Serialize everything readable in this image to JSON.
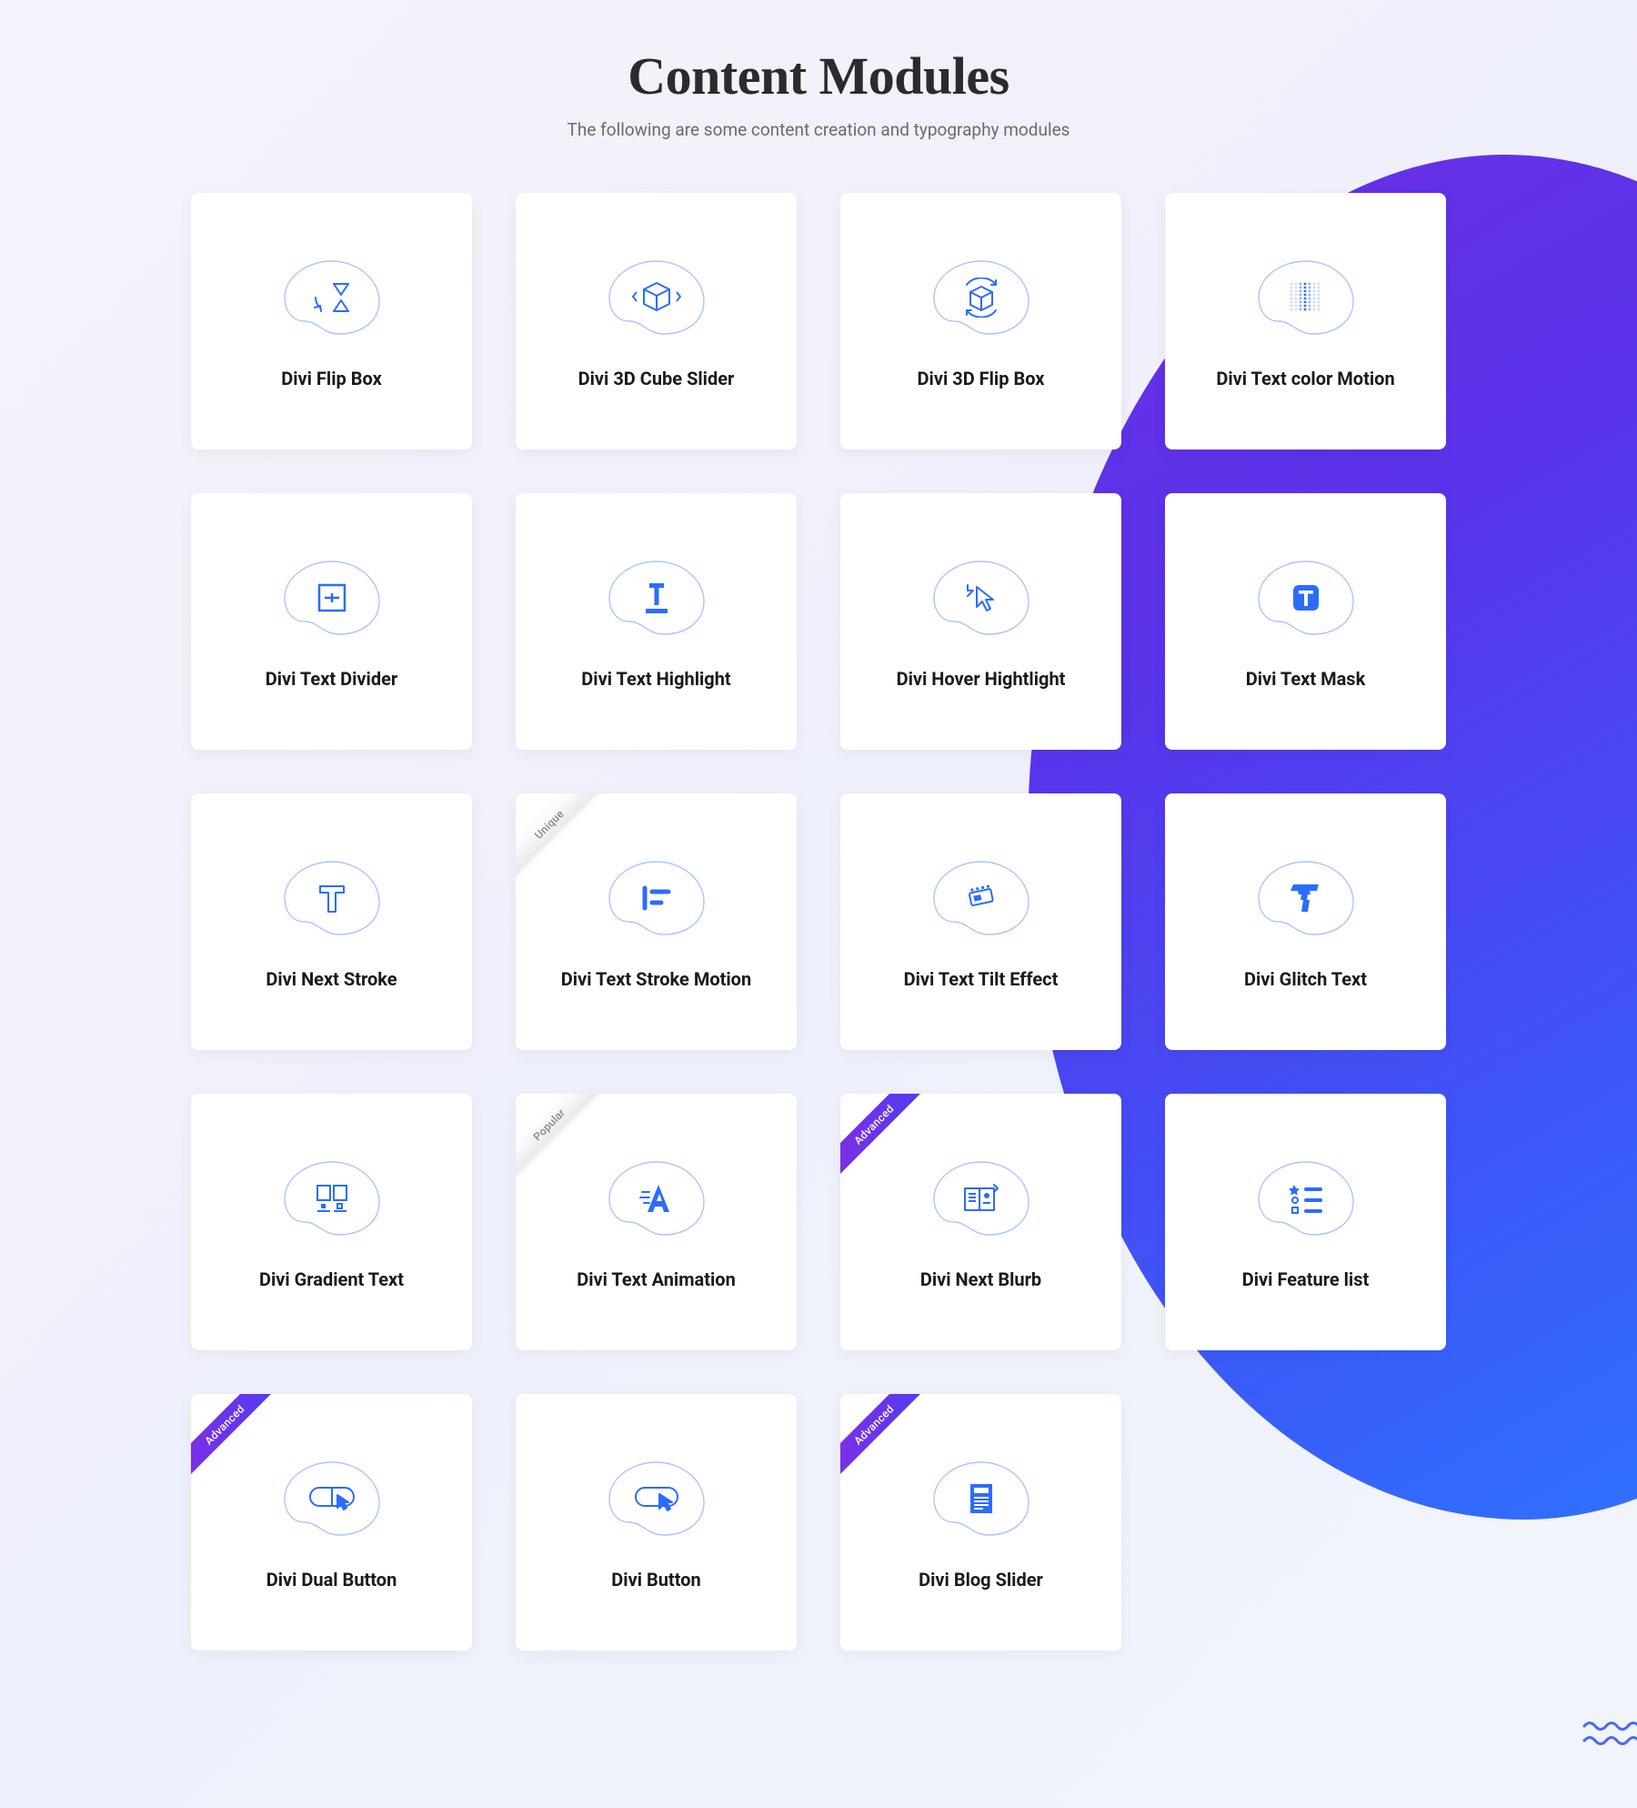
{
  "heading": {
    "title": "Content Modules",
    "subtitle": "The following are some content creation and typography modules"
  },
  "ribbons": {
    "unique": "Unique",
    "popular": "Popular",
    "advanced": "Advanced"
  },
  "cards": [
    {
      "label": "Divi Flip Box",
      "icon": "flip-hourglass-icon",
      "ribbon": null
    },
    {
      "label": "Divi 3D Cube Slider",
      "icon": "cube-slider-icon",
      "ribbon": null
    },
    {
      "label": "Divi 3D Flip Box",
      "icon": "cube-rotate-icon",
      "ribbon": null
    },
    {
      "label": "Divi Text color Motion",
      "icon": "dots-motion-icon",
      "ribbon": null
    },
    {
      "label": "Divi Text Divider",
      "icon": "divider-box-icon",
      "ribbon": null
    },
    {
      "label": "Divi Text Highlight",
      "icon": "text-highlight-icon",
      "ribbon": null
    },
    {
      "label": "Divi Hover Hightlight",
      "icon": "cursor-arrow-icon",
      "ribbon": null
    },
    {
      "label": "Divi Text Mask",
      "icon": "text-mask-icon",
      "ribbon": null
    },
    {
      "label": "Divi Next Stroke",
      "icon": "stroke-t-icon",
      "ribbon": null
    },
    {
      "label": "Divi Text Stroke Motion",
      "icon": "stroke-lines-icon",
      "ribbon": "unique"
    },
    {
      "label": "Divi Text Tilt Effect",
      "icon": "tilt-box-icon",
      "ribbon": null
    },
    {
      "label": "Divi Glitch Text",
      "icon": "glitch-t-icon",
      "ribbon": null
    },
    {
      "label": "Divi Gradient Text",
      "icon": "gradient-boxes-icon",
      "ribbon": null
    },
    {
      "label": "Divi Text Animation",
      "icon": "text-animation-icon",
      "ribbon": "popular"
    },
    {
      "label": "Divi Next Blurb",
      "icon": "blurb-book-icon",
      "ribbon": "advanced"
    },
    {
      "label": "Divi Feature list",
      "icon": "feature-list-icon",
      "ribbon": null
    },
    {
      "label": "Divi Dual Button",
      "icon": "dual-button-icon",
      "ribbon": "advanced"
    },
    {
      "label": "Divi Button",
      "icon": "button-cursor-icon",
      "ribbon": null
    },
    {
      "label": "Divi Blog Slider",
      "icon": "blog-page-icon",
      "ribbon": "advanced"
    }
  ],
  "colors": {
    "iconStroke": "#2b6cff",
    "iconFill": "#2b6cff",
    "kidneyStroke": "#a8c6ff"
  }
}
